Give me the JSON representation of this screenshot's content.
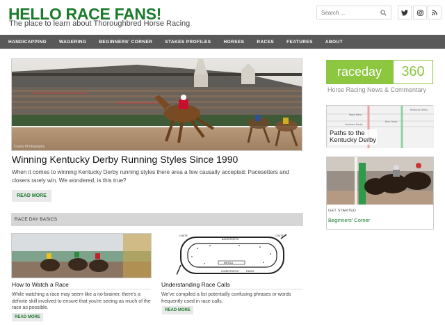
{
  "header": {
    "site_title": "HELLO RACE FANS!",
    "tagline": "The place to learn about Thoroughbred Horse Racing",
    "search_placeholder": "Search ..."
  },
  "nav": [
    "HANDICAPPING",
    "WAGERING",
    "BEGINNERS' CORNER",
    "STAKES PROFILES",
    "HORSES",
    "RACES",
    "FEATURES",
    "ABOUT"
  ],
  "hero": {
    "credit": "Coady Photography",
    "title": "Winning Kentucky Derby Running Styles Since 1990",
    "excerpt": "When it comes to winning Kentucky Derby running styles there area a few causally accepted: Pacesetters and closers rarely win. We wondered, is this true?",
    "read_more": "READ MORE"
  },
  "section": {
    "title": "RACE DAY BASICS"
  },
  "cards": [
    {
      "title": "How to Watch a Race",
      "excerpt": "While watching a race may seem like a no-brainer, there's a definite skill involved to ensure that you're seeing as much of the race as possible.",
      "read_more": "READ MORE"
    },
    {
      "title": "Understanding Race Calls",
      "excerpt": "We've compiled a list potentially confusing phrases or words frequently used in race calls.",
      "read_more": "READ MORE"
    }
  ],
  "sidebar": {
    "raceday_left": "raceday",
    "raceday_right": "360",
    "raceday_sub": "Horse Racing News & Commentary",
    "paths_title_1": "Paths to the",
    "paths_title_2": "Kentucky Derby",
    "paths_map_label_1": "Kentucky Derby",
    "paths_map_label_2": "Wood Mem.",
    "paths_map_label_3": "Blue Grass",
    "paths_map_label_4": "Louisiana Derby",
    "get_started": "GET STARTED",
    "beginners_link": "Beginners' Corner"
  },
  "track_diagram": {
    "backstretch": "BACKSTRETCH",
    "homestretch": "HOMESTRETCH",
    "finish": "FINISH",
    "chute_left": "CHUTE",
    "chute_right": "CHUTE",
    "infield": "INFIELD"
  },
  "colors": {
    "brand_green": "#1b7a2b",
    "raceday_green": "#8dc63f",
    "nav_bg": "#595959"
  }
}
